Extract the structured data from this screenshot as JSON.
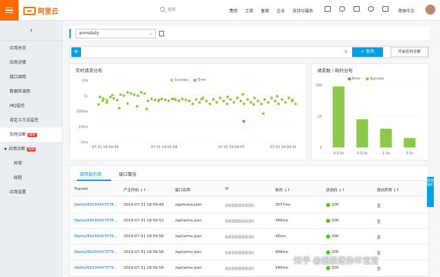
{
  "topbar": {
    "logo_text": "阿里云",
    "search_placeholder": "搜索",
    "nav": [
      "费用",
      "工单",
      "备案",
      "企业",
      "支持与服务"
    ],
    "lang": "简体中文",
    "icons": [
      "terminal-icon",
      "bell-icon",
      "cart-icon",
      "help-icon",
      "home-icon"
    ]
  },
  "sidebar": {
    "collapse_glyph": "‹",
    "items": [
      {
        "label": "应用总览"
      },
      {
        "label": "应用详情"
      },
      {
        "label": "接口调用"
      },
      {
        "label": "数据库调用"
      },
      {
        "label": "MQ监控"
      },
      {
        "label": "自定义方法监控"
      },
      {
        "label": "实时诊断",
        "badge": "NEW",
        "active": true
      },
      {
        "label": "应用诊断",
        "badge": "NEW",
        "group": true
      },
      {
        "label": "异常",
        "sub": true
      },
      {
        "label": "线程",
        "sub": true
      },
      {
        "label": "应用设置"
      }
    ]
  },
  "app_selector": {
    "value": "armsdaily"
  },
  "filter": {
    "query_label": "查询",
    "realtime_label": "开启实时诊断"
  },
  "scatter_chart": {
    "title": "实时请求分布",
    "legend": [
      "Success",
      "Error"
    ],
    "y_ticks": [
      "10s",
      "1s",
      "100ms",
      "10ms",
      "1ms"
    ],
    "x_ticks": [
      "07-31 18:59:49",
      "07-31 19:01:08",
      "07-31 19:04:05",
      "07-31 19:04:41"
    ]
  },
  "bar_chart": {
    "title": "请求数 / 耗时分布",
    "legend": [
      "Error",
      "Success"
    ],
    "y_ticks": [
      "100",
      "10",
      "1"
    ],
    "x_ticks": [
      "0-0.5s",
      "0.5-1s",
      "1-3s",
      "3-5s"
    ]
  },
  "chart_data": [
    {
      "type": "scatter",
      "title": "实时请求分布",
      "x_ticks": [
        "07-31 18:59:49",
        "07-31 19:01:08",
        "07-31 19:04:05",
        "07-31 19:04:41"
      ],
      "y_scale": "log",
      "ylim": [
        "1ms",
        "10s"
      ],
      "series": [
        {
          "name": "Success",
          "color": "#8cc84b"
        },
        {
          "name": "Error",
          "color": "#f05a5a"
        }
      ]
    },
    {
      "type": "bar",
      "title": "请求数 / 耗时分布",
      "categories": [
        "0-0.5s",
        "0.5-1s",
        "1-3s",
        "3-5s"
      ],
      "y_scale": "log",
      "ylim": [
        1,
        100
      ],
      "series": [
        {
          "name": "Success",
          "values": [
            90,
            8,
            4,
            2
          ],
          "color": "#8cc84b"
        },
        {
          "name": "Error",
          "values": [
            0,
            0,
            0,
            0
          ],
          "color": "#f05a5a"
        }
      ]
    }
  ],
  "table": {
    "tabs": [
      "调用链列表",
      "接口聚合"
    ],
    "headers": [
      "TraceId",
      "产生时间 ↓↑",
      "接口名称",
      "IP",
      "耗时 ↓↑",
      "状态码 ↓↑",
      "抛出异常 ↓↑"
    ],
    "rows": [
      {
        "trace": "0befa269156457078...",
        "time": "2019-07-31 18:59:49",
        "api": "/api/trace.json",
        "cost": "3077ms",
        "status": "200",
        "exc": "否"
      },
      {
        "trace": "0befa269156457078...",
        "time": "2019-07-31 18:59:52",
        "api": "/api/arms.json",
        "cost": "346ms",
        "status": "200",
        "exc": "否"
      },
      {
        "trace": "0befa269156457079...",
        "time": "2019-07-31 18:59:58",
        "api": "/api/arms.json",
        "cost": "45ms",
        "status": "200",
        "exc": "否"
      },
      {
        "trace": "0befa269156457079...",
        "time": "2019-07-31 18:59:58",
        "api": "/api/arms.json",
        "cost": "408ms",
        "status": "200",
        "exc": "否"
      },
      {
        "trace": "0befa269156457079...",
        "time": "2019-07-31 18:59:58",
        "api": "/api/arms.json",
        "cost": "245ms",
        "status": "200",
        "exc": "否"
      }
    ]
  },
  "side_tab": "联系我们",
  "watermark": "知乎 @超级迷你羊宝宝",
  "colors": {
    "accent": "#00a0e9",
    "brand": "#ff6a00",
    "success": "#8cc84b",
    "error": "#f05a5a"
  }
}
